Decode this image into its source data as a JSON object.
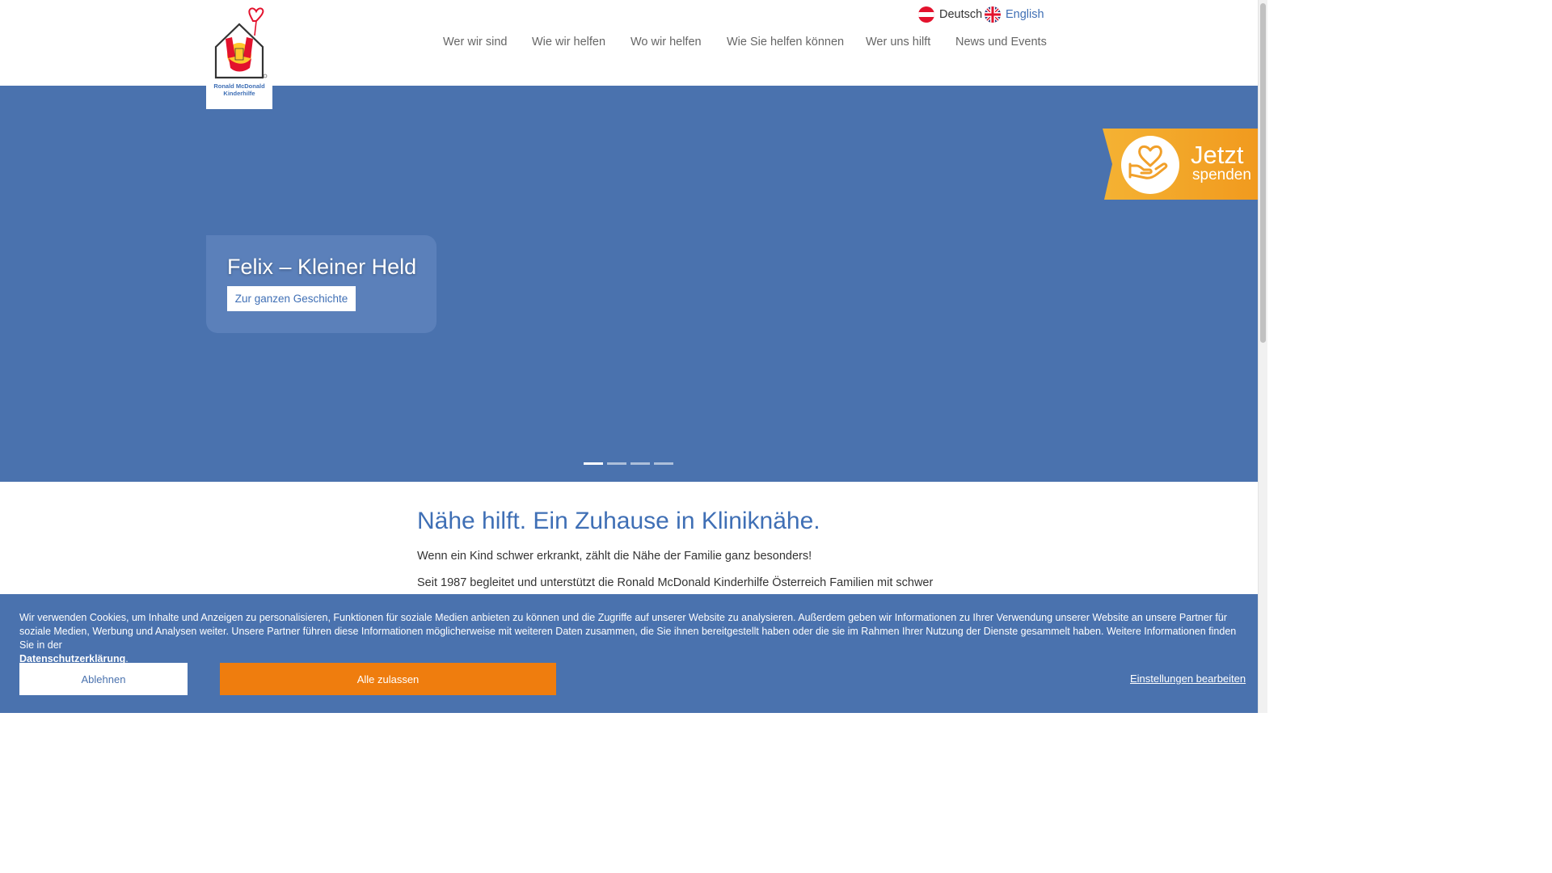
{
  "brand": {
    "logo_text_line1": "Ronald McDonald",
    "logo_text_line2": "Kinderhilfe",
    "colors": {
      "primary_blue": "#4a72ae",
      "accent_orange": "#ef7d0e",
      "logo_red": "#e3122d",
      "logo_yellow": "#ffc72c"
    }
  },
  "languages": [
    {
      "label": "Deutsch",
      "icon": "austria-flag-icon"
    },
    {
      "label": "English",
      "icon": "uk-flag-icon"
    }
  ],
  "nav": {
    "items": [
      {
        "label": "Wer wir sind"
      },
      {
        "label": "Wie wir helfen"
      },
      {
        "label": "Wo wir helfen"
      },
      {
        "label": "Wie Sie helfen können"
      },
      {
        "label": "Wer uns hilft"
      },
      {
        "label": "News und Events"
      }
    ]
  },
  "hero": {
    "story_title": "Felix – Kleiner Held",
    "story_button": "Zur ganzen Geschichte",
    "slide_count": 4,
    "active_slide": 1
  },
  "donate": {
    "line1": "Jetzt",
    "line2": "spenden",
    "icon": "heart-in-hand-icon"
  },
  "intro": {
    "title": "Nähe hilft. Ein Zuhause in Kliniknähe.",
    "paragraph1": "Wenn ein Kind schwer erkrankt, zählt die Nähe der Familie ganz besonders!",
    "paragraph2": "Seit 1987 begleitet und unterstützt die Ronald McDonald Kinderhilfe Österreich Familien mit schwer"
  },
  "cookie": {
    "text": "Wir verwenden Cookies, um Inhalte und Anzeigen zu personalisieren, Funktionen für soziale Medien anbieten zu können und die Zugriffe auf unserer Website zu analysieren. Außerdem geben wir Informationen zu Ihrer Verwendung unserer Website an unsere Partner für soziale Medien, Werbung und Analysen weiter. Unsere Partner führen diese Informationen möglicherweise mit weiteren Daten zusammen, die Sie ihnen bereitgestellt haben oder die sie im Rahmen Ihrer Nutzung der Dienste gesammelt haben. Weitere Informationen finden Sie in der",
    "privacy_link": "Datenschutzerklärung",
    "privacy_suffix": ".",
    "decline_label": "Ablehnen",
    "accept_label": "Alle zulassen",
    "settings_label": "Einstellungen bearbeiten"
  }
}
